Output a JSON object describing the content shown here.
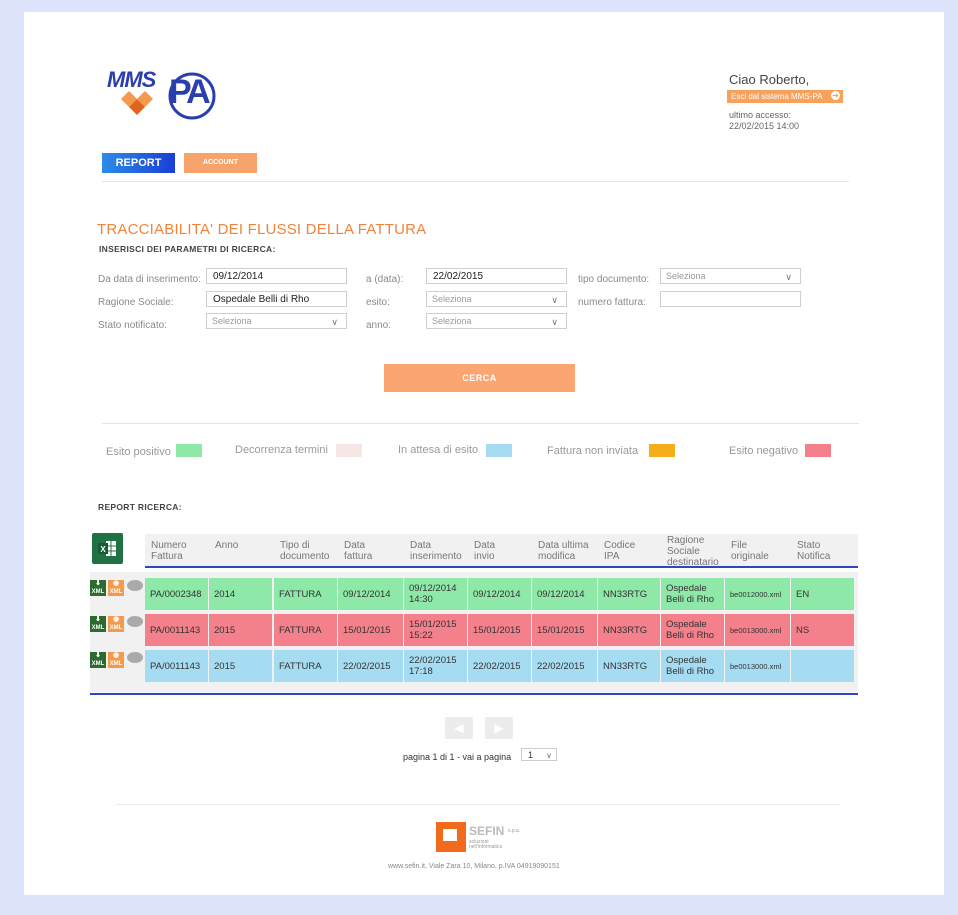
{
  "header": {
    "logo_text": "MMS",
    "logo_pa": "PA",
    "greeting": "Ciao Roberto,",
    "exit_label": "Esci dal sistema MMS-PA",
    "last_access_label": "ultimo accesso:",
    "last_access_value": "22/02/2015 14:00"
  },
  "tabs": {
    "report": "REPORT",
    "account": "ACCOUNT"
  },
  "search": {
    "title": "TRACCIABILITA' DEI FLUSSI DELLA FATTURA",
    "subtitle": "INSERISCI DEI PARAMETRI DI RICERCA:",
    "labels": {
      "from_date": "Da data di inserimento:",
      "to_date": "a (data):",
      "doc_type": "tipo documento:",
      "company": "Ragione Sociale:",
      "outcome": "esito:",
      "invoice_number": "numero fattura:",
      "notified_state": "Stato notificato:",
      "year": "anno:"
    },
    "values": {
      "from_date": "09/12/2014",
      "to_date": "22/02/2015",
      "company": "Ospedale Belli di Rho",
      "invoice_number": ""
    },
    "select_placeholder": "Seleziona",
    "button": "CERCA"
  },
  "legend": [
    {
      "label": "Esito positivo",
      "color": "#8ee8a8"
    },
    {
      "label": "Decorrenza termini",
      "color": "#f7e6e6"
    },
    {
      "label": "In attesa di esito",
      "color": "#a6dcf2"
    },
    {
      "label": "Fattura non inviata",
      "color": "#f6ad1b"
    },
    {
      "label": "Esito negativo",
      "color": "#f4808c"
    }
  ],
  "report": {
    "title": "REPORT RICERCA:",
    "columns": [
      "Numero\nFattura",
      "Anno",
      "Tipo di\ndocumento",
      "Data\nfattura",
      "Data\ninserimento",
      "Data\ninvio",
      "Data ultima\nmodifica",
      "Codice\nIPA",
      "Ragione\nSociale\ndestinatario",
      "File\noriginale",
      "Stato\nNotifica"
    ],
    "rows": [
      {
        "color": "#8ee8a8",
        "cells": [
          "PA/0002348",
          "2014",
          "FATTURA",
          "09/12/2014",
          "09/12/2014\n14:30",
          "09/12/2014",
          "09/12/2014",
          "NN33RTG",
          "Ospedale\nBelli di Rho",
          "be0012000.xml",
          "EN"
        ]
      },
      {
        "color": "#f4808c",
        "cells": [
          "PA/0011143",
          "2015",
          "FATTURA",
          "15/01/2015",
          "15/01/2015\n15:22",
          "15/01/2015",
          "15/01/2015",
          "NN33RTG",
          "Ospedale\nBelli di Rho",
          "be0013000.xml",
          "NS"
        ]
      },
      {
        "color": "#a6dcf2",
        "cells": [
          "PA/0011143",
          "2015",
          "FATTURA",
          "22/02/2015",
          "22/02/2015\n17:18",
          "22/02/2015",
          "22/02/2015",
          "NN33RTG",
          "Ospedale\nBelli di Rho",
          "be0013000.xml",
          ""
        ]
      }
    ],
    "row_icons": {
      "download": "XML",
      "view": "XML"
    }
  },
  "pager": {
    "text": "pagina 1 di 1 - vai a pagina",
    "page_value": "1",
    "prev_icon": "chevron-left-icon",
    "next_icon": "chevron-right-icon"
  },
  "footer": {
    "brand": "SEFIN",
    "brand_suffix": "s.p.a.",
    "tagline": "soluzioni\nnell'informatica",
    "address": "www.sefin.it, Viale Zara 10, Milano, p.IVA 04919090151"
  }
}
